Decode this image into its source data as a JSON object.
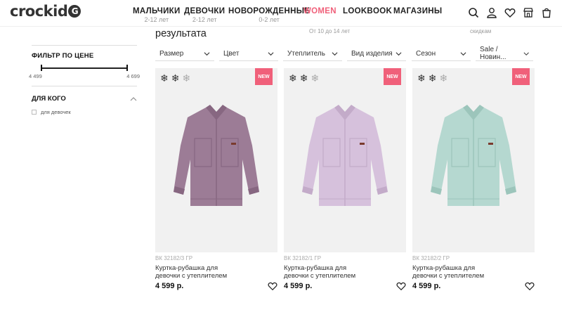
{
  "brand": {
    "logo_text": "crockid",
    "logo_mark": "G"
  },
  "nav": [
    {
      "label": "МАЛЬЧИКИ",
      "sub": "2-12 лет"
    },
    {
      "label": "ДЕВОЧКИ",
      "sub": "2-12 лет"
    },
    {
      "label": "НОВОРОЖДЕННЫЕ",
      "sub": "0-2 лет"
    },
    {
      "label": "WOMEN",
      "sub": ""
    },
    {
      "label": "LOOKBOOK",
      "sub": ""
    },
    {
      "label": "МАГАЗИНЫ",
      "sub": ""
    }
  ],
  "header_icons": [
    "search-icon",
    "user-icon",
    "heart-icon",
    "store-icon",
    "cart-icon"
  ],
  "accent_color": "#f0607a",
  "results": {
    "title": "результата",
    "promo_left": "От 10 до 14 лет",
    "promo_right": "скидкам"
  },
  "sidebar": {
    "price_filter_title": "ФИЛЬТР ПО ЦЕНЕ",
    "price_min": "4 499",
    "price_max": "4 699",
    "who_title": "ДЛЯ КОГО",
    "who_option": "для девочек"
  },
  "filters": [
    "Размер",
    "Цвет",
    "Утеплитель",
    "Вид изделия",
    "Сезон",
    "Sale / Новин..."
  ],
  "products": [
    {
      "sku": "ВК 32182/3 ГР",
      "name": "Куртка-рубашка для девочки с утеплителем",
      "price": "4 599 р.",
      "badge": "NEW",
      "shirt_color": "#9c7c96",
      "shirt_shade": "#876781",
      "warmth": 2
    },
    {
      "sku": "ВК 32182/1 ГР",
      "name": "Куртка-рубашка для девочки с утеплителем",
      "price": "4 599 р.",
      "badge": "NEW",
      "shirt_color": "#d6c1dc",
      "shirt_shade": "#c3abc9",
      "warmth": 2
    },
    {
      "sku": "ВК 32182/2 ГР",
      "name": "Куртка-рубашка для девочки с утеплителем",
      "price": "4 599 р.",
      "badge": "NEW",
      "shirt_color": "#b5d8d0",
      "shirt_shade": "#9cc5bb",
      "warmth": 2
    }
  ]
}
